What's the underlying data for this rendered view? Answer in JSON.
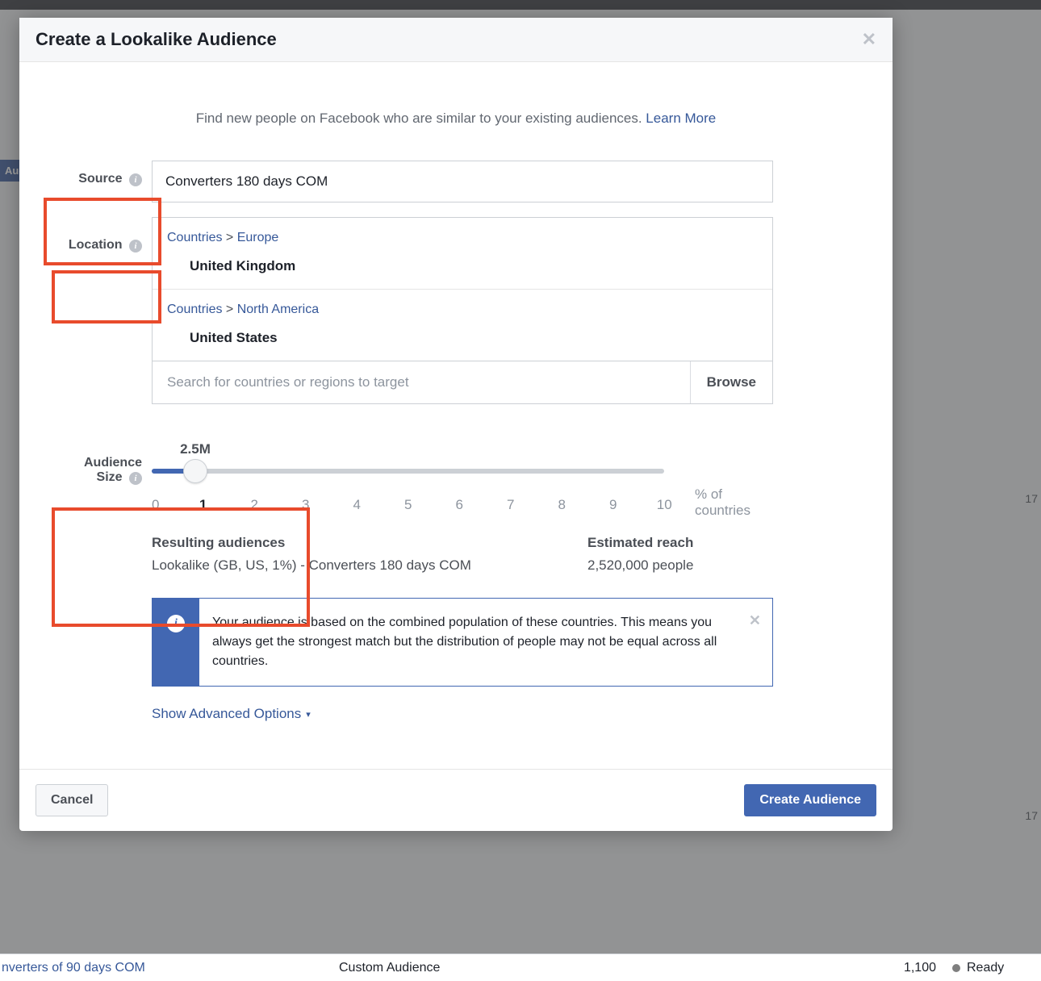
{
  "modal": {
    "title": "Create a Lookalike Audience",
    "intro_text": "Find new people on Facebook who are similar to your existing audiences. ",
    "learn_more": "Learn More"
  },
  "source": {
    "label": "Source",
    "value": "Converters 180 days COM"
  },
  "location": {
    "label": "Location",
    "breadcrumb_root": "Countries",
    "regions": [
      {
        "continent": "Europe",
        "country": "United Kingdom"
      },
      {
        "continent": "North America",
        "country": "United States"
      }
    ],
    "search_placeholder": "Search for countries or regions to target",
    "browse": "Browse"
  },
  "size": {
    "label_line1": "Audience",
    "label_line2": "Size",
    "bubble": "2.5M",
    "ticks": [
      "0",
      "1",
      "2",
      "3",
      "4",
      "5",
      "6",
      "7",
      "8",
      "9",
      "10"
    ],
    "active_tick_index": 1,
    "pct_label": "% of countries"
  },
  "resulting": {
    "head": "Resulting audiences",
    "value": "Lookalike (GB, US, 1%) - Converters 180 days COM"
  },
  "reach": {
    "head": "Estimated reach",
    "value": "2,520,000 people"
  },
  "note": {
    "text": "Your audience is based on the combined population of these countries. This means you always get the strongest match but the distribution of people may not be equal across all countries."
  },
  "advanced": {
    "label": "Show Advanced Options"
  },
  "footer": {
    "cancel": "Cancel",
    "create": "Create Audience"
  },
  "bg": {
    "pill": "Aud",
    "bottom_name": "nverters of 90 days COM",
    "bottom_type": "Custom Audience",
    "bottom_count": "1,100",
    "bottom_status": "Ready",
    "r17": "17"
  }
}
